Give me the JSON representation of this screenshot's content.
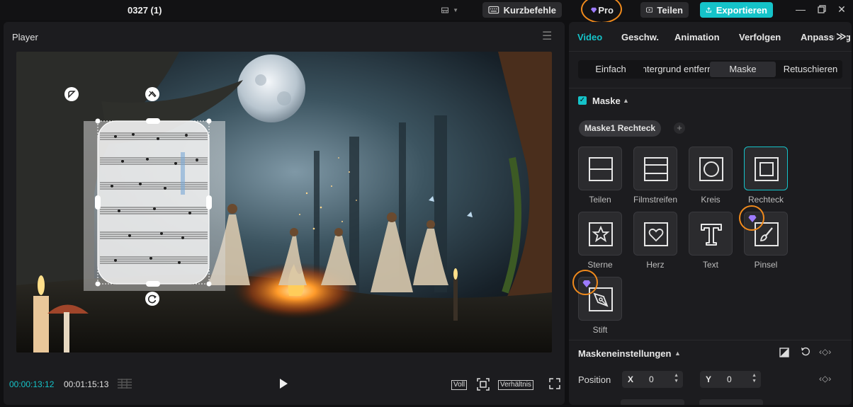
{
  "titlebar": {
    "project_title": "0327 (1)",
    "shortcuts_label": "Kurzbefehle",
    "pro_label": "Pro",
    "share_label": "Teilen",
    "export_label": "Exportieren",
    "accent_color": "#15c3c9",
    "highlight_ring_color": "#f08a1c"
  },
  "player": {
    "label": "Player",
    "current_time": "00:00:13:12",
    "total_time": "00:01:15:13",
    "full_label": "Voll",
    "ratio_label": "Verhältnis"
  },
  "inspector": {
    "tabs": [
      "Video",
      "Geschw.",
      "Animation",
      "Verfolgen",
      "Anpassung"
    ],
    "active_tab": "Video",
    "subtabs": [
      "Einfach",
      "Hintergrund entfernen",
      "Maske",
      "Retuschieren"
    ],
    "active_subtab": "Maske",
    "mask_section": {
      "title": "Maske",
      "enabled": true,
      "current_mask_chip": "Maske1 Rechteck",
      "shapes": [
        {
          "label": "Teilen",
          "icon": "split-mask-icon",
          "selected": false,
          "pro": false
        },
        {
          "label": "Filmstreifen",
          "icon": "filmstrip-mask-icon",
          "selected": false,
          "pro": false
        },
        {
          "label": "Kreis",
          "icon": "circle-mask-icon",
          "selected": false,
          "pro": false
        },
        {
          "label": "Rechteck",
          "icon": "rectangle-mask-icon",
          "selected": true,
          "pro": false
        },
        {
          "label": "Sterne",
          "icon": "star-mask-icon",
          "selected": false,
          "pro": false
        },
        {
          "label": "Herz",
          "icon": "heart-mask-icon",
          "selected": false,
          "pro": false
        },
        {
          "label": "Text",
          "icon": "text-mask-icon",
          "selected": false,
          "pro": false
        },
        {
          "label": "Pinsel",
          "icon": "brush-mask-icon",
          "selected": false,
          "pro": true
        },
        {
          "label": "Stift",
          "icon": "pen-mask-icon",
          "selected": false,
          "pro": true
        }
      ]
    },
    "mask_settings": {
      "title": "Maskeneinstellungen",
      "position_label": "Position",
      "x_label": "X",
      "x_value": "0",
      "y_label": "Y",
      "y_value": "0"
    }
  }
}
